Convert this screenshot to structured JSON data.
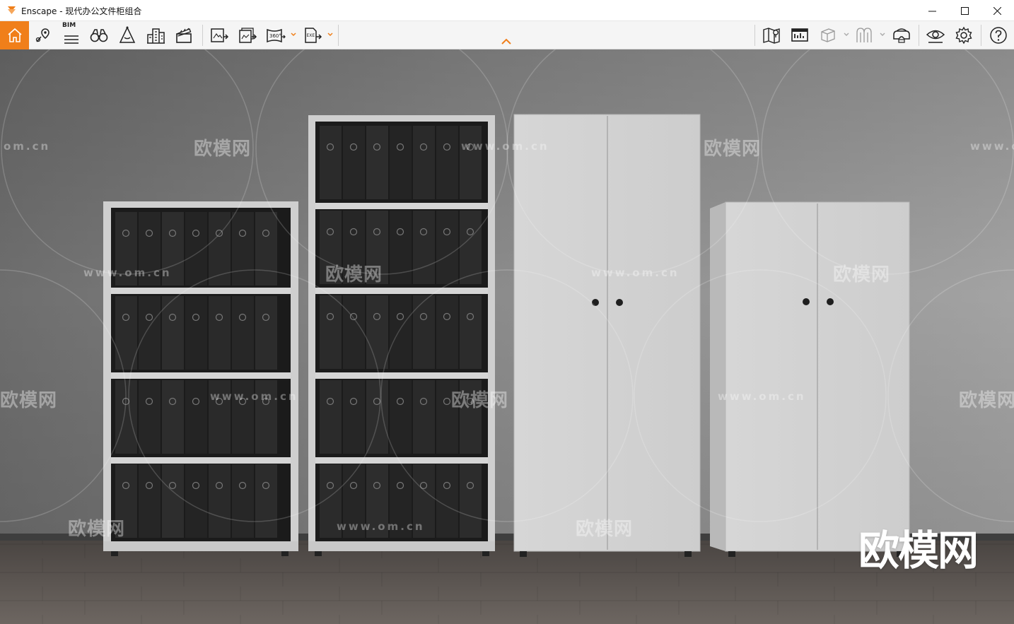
{
  "window": {
    "title": "Enscape - 现代办公文件柜组合",
    "controls": [
      "minimize",
      "maximize",
      "close"
    ]
  },
  "toolbar": {
    "bim_label": "BIM",
    "left_tools": [
      "home-icon",
      "location-pin-icon",
      "bim-list-icon",
      "binoculars-icon",
      "perspective-icon",
      "buildings-icon",
      "clapperboard-icon"
    ],
    "export_tools": [
      "render-image-icon",
      "batch-render-icon",
      "panorama-360-icon",
      "export-exe-icon"
    ],
    "right_tools": [
      "map-icon",
      "screenshot-settings-icon",
      "cube-view-icon",
      "asset-library-icon",
      "vr-headset-icon",
      "visual-settings-icon",
      "settings-gear-icon",
      "help-icon"
    ]
  },
  "scene": {
    "watermark_url": "www.om.cn",
    "watermark_url_short": "om.cn",
    "watermark_cn": "欧模网",
    "brand": "欧模网",
    "colors": {
      "accent": "#f07f1a",
      "wall": "#8c8c8c",
      "floor": "#5e5a56",
      "cabinet": "#d9d9d9",
      "binder": "#2a2a2a"
    }
  }
}
